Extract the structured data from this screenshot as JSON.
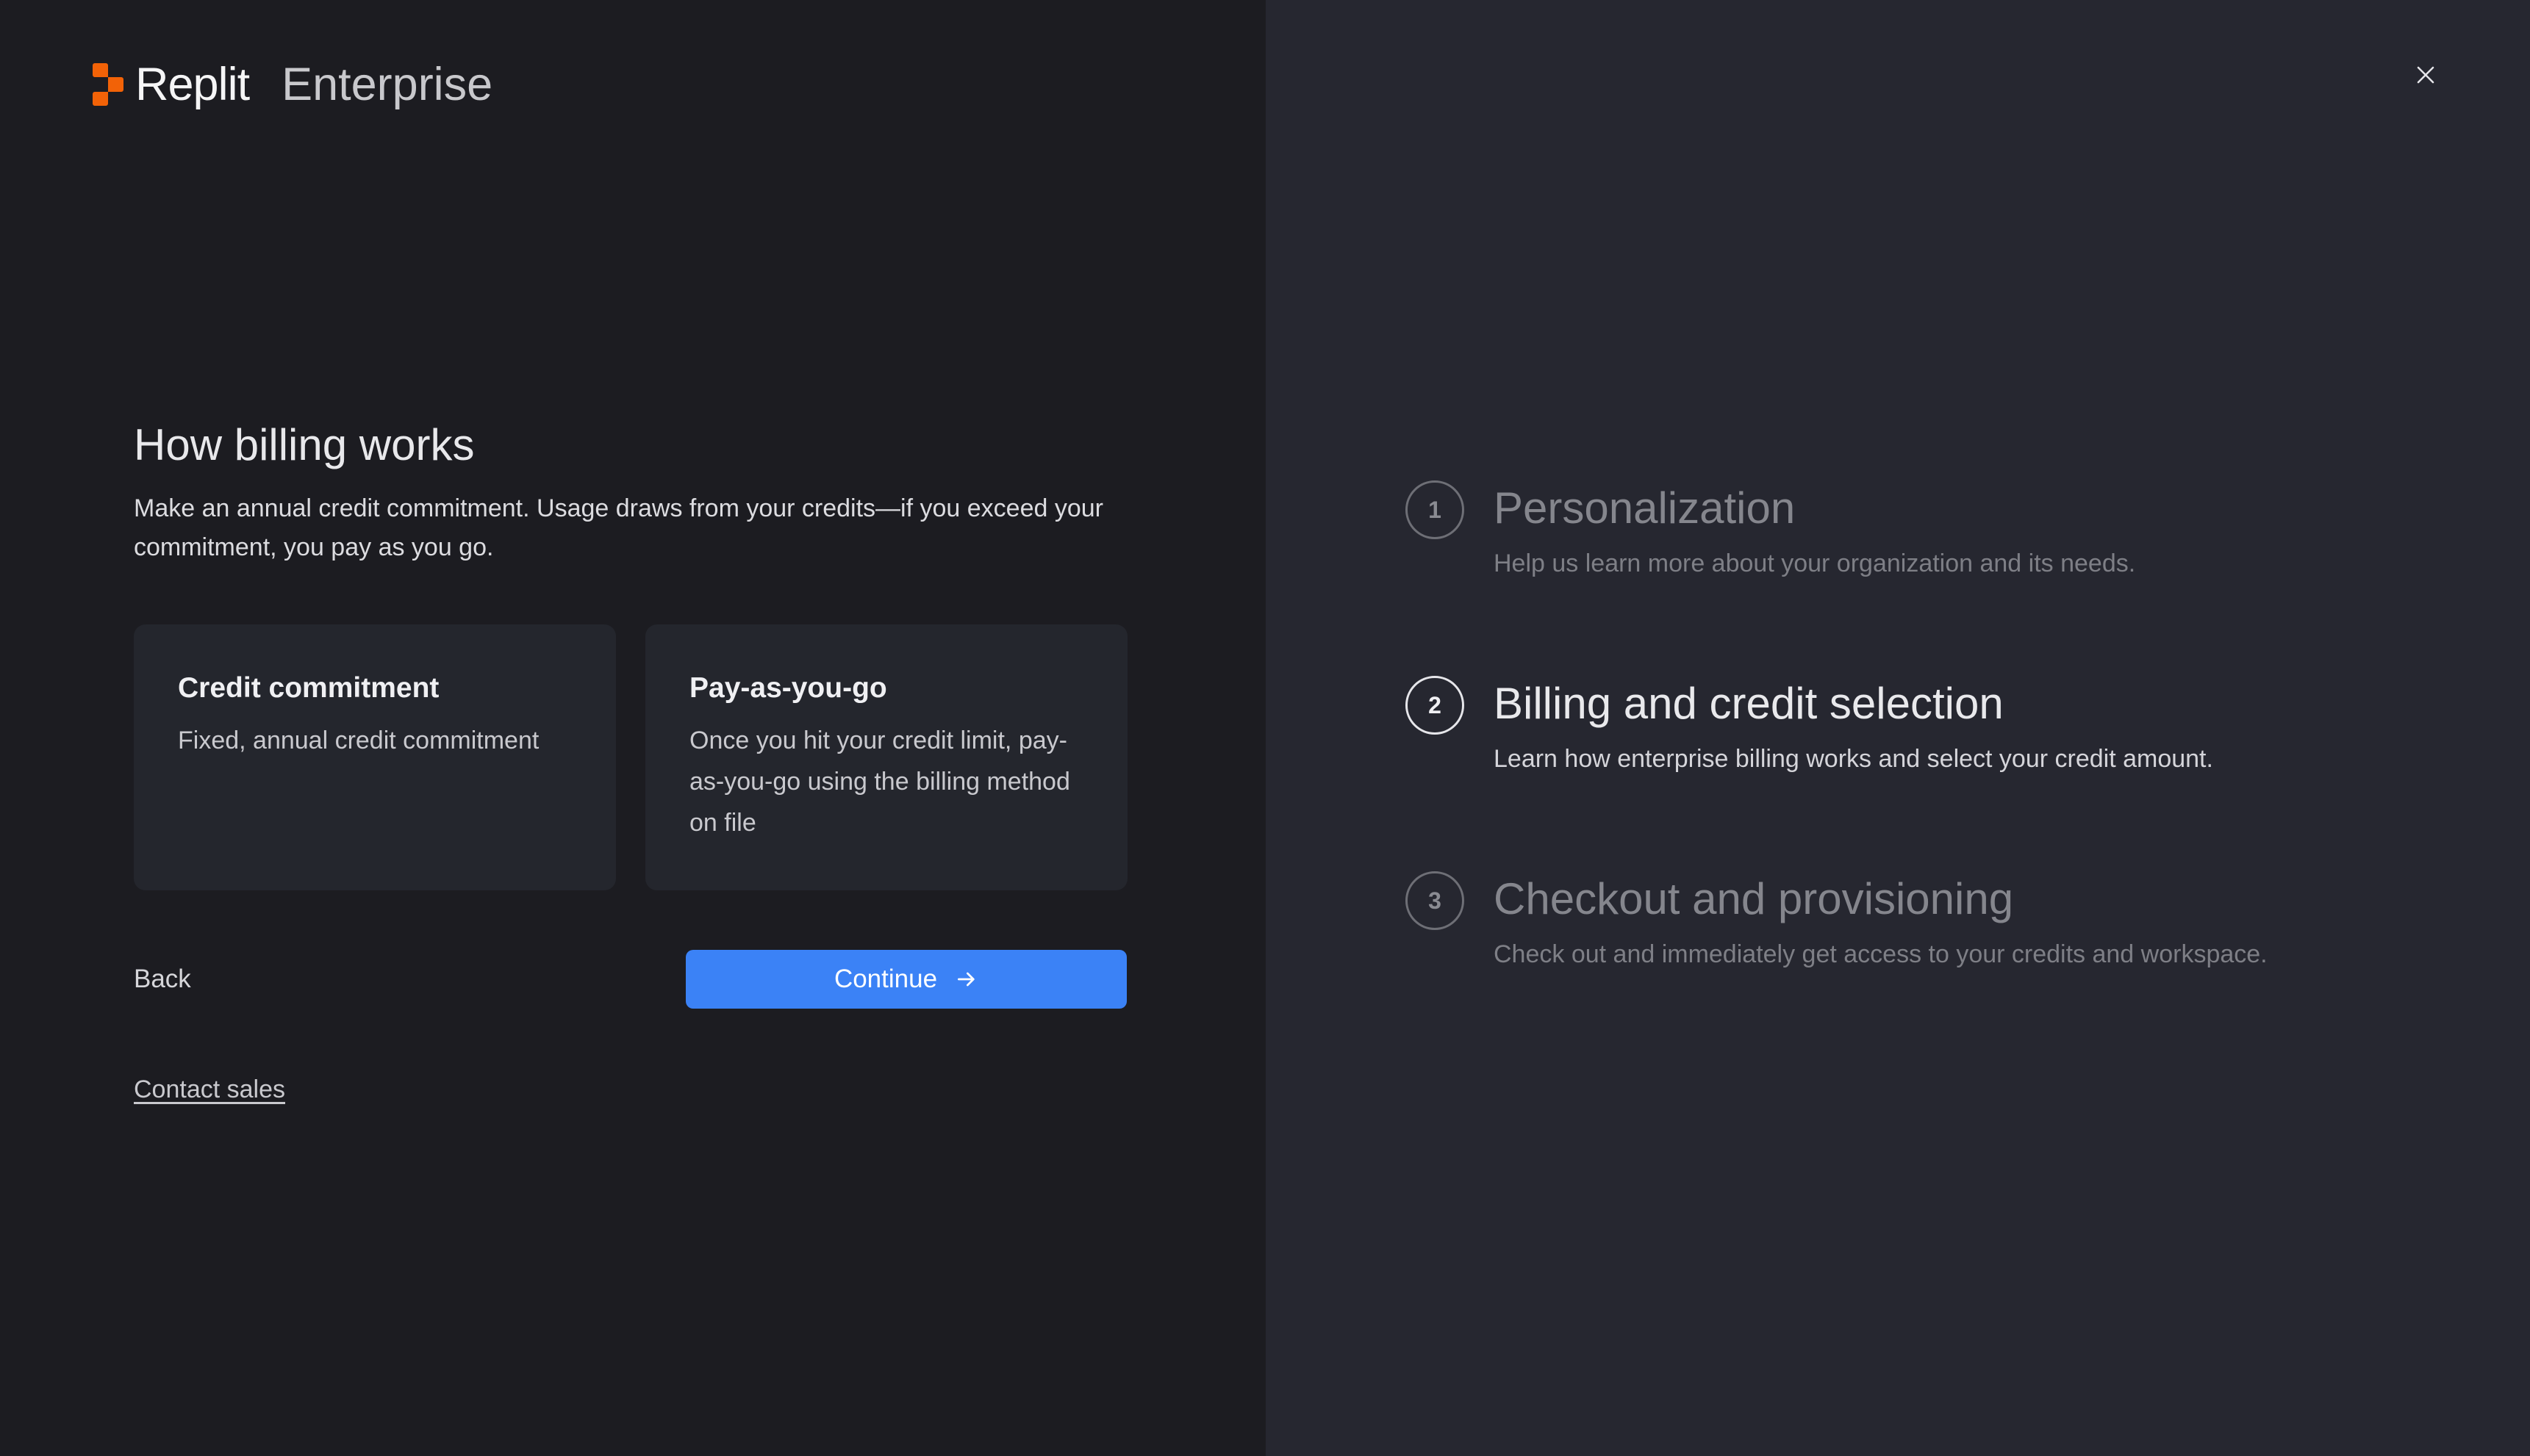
{
  "brand": {
    "wordmark": "Replit",
    "product": "Enterprise",
    "logo_color": "#f26207",
    "logo_icon": "replit-logo-icon"
  },
  "main": {
    "heading": "How billing works",
    "intro": "Make an annual credit commitment. Usage draws from your credits—if you exceed your commitment, you pay as you go.",
    "cards": [
      {
        "title": "Credit commitment",
        "description": "Fixed, annual credit commitment"
      },
      {
        "title": "Pay-as-you-go",
        "description": "Once you hit your credit limit, pay-as-you-go using the billing method on file"
      }
    ],
    "back_label": "Back",
    "continue_label": "Continue",
    "continue_icon": "arrow-right-icon",
    "contact_sales_label": "Contact sales"
  },
  "steps": [
    {
      "number": "1",
      "title": "Personalization",
      "description": "Help us learn more about your organization and its needs.",
      "active": false
    },
    {
      "number": "2",
      "title": "Billing and credit selection",
      "description": "Learn how enterprise billing works and select your credit amount.",
      "active": true
    },
    {
      "number": "3",
      "title": "Checkout and provisioning",
      "description": "Check out and immediately get access to your credits and workspace.",
      "active": false
    }
  ],
  "close_icon": "close-icon",
  "colors": {
    "accent": "#3b82f6",
    "left_background": "#1c1c21",
    "right_background": "#262730",
    "card_background": "#24262d"
  }
}
